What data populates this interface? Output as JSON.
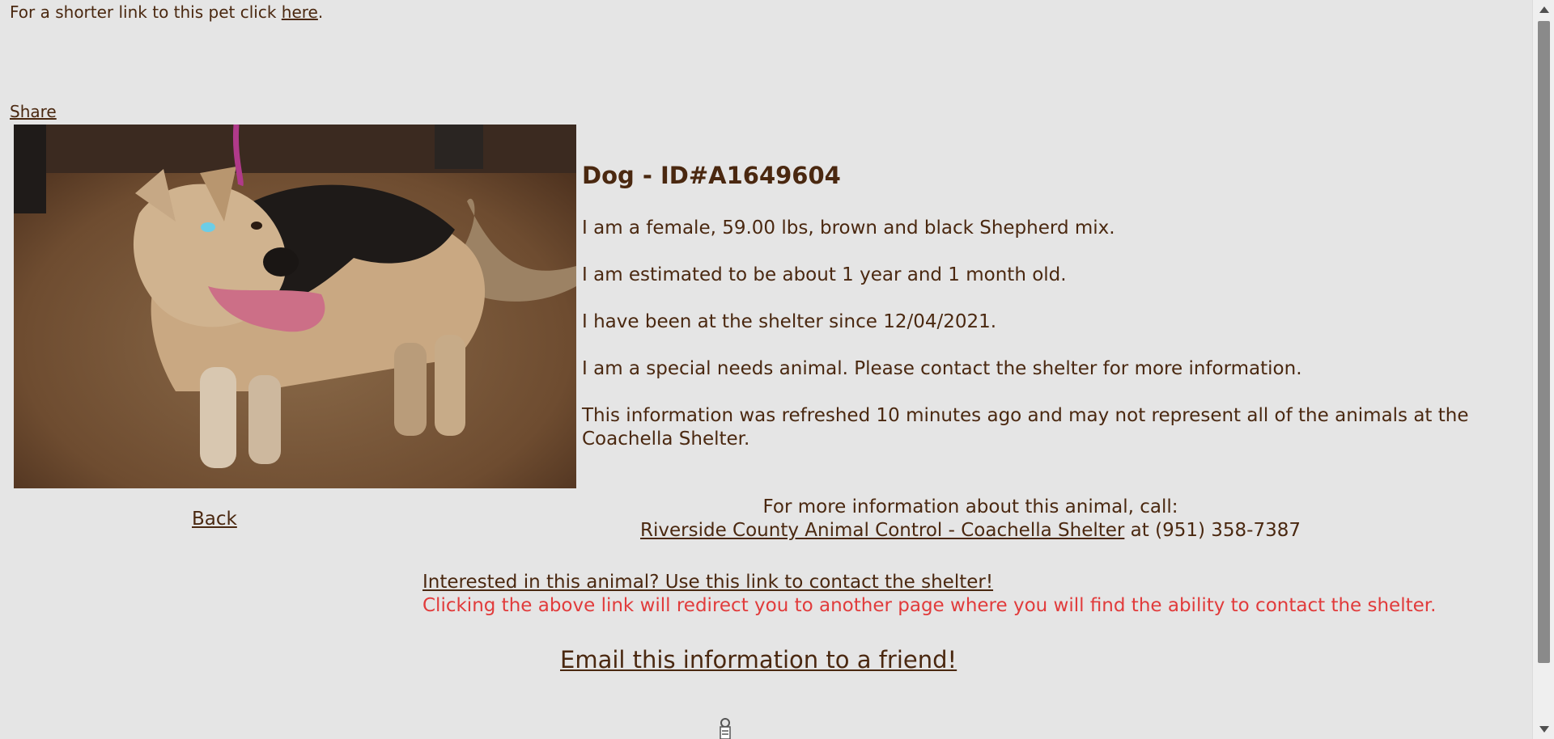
{
  "top": {
    "prefix": "For a shorter link to this pet click ",
    "link": "here",
    "suffix": "."
  },
  "share_label": "Share",
  "photo": {
    "icon": "dog-photo"
  },
  "details": {
    "title": "Dog - ID#A1649604",
    "line1": "I am a female, 59.00 lbs, brown and black Shepherd mix.",
    "line2": "I am estimated to be about 1 year and 1 month old.",
    "line3": "I have been at the shelter since 12/04/2021.",
    "line4": "I am a special needs animal. Please contact the shelter for more information.",
    "line5": "This information was refreshed 10 minutes ago and may not represent all of the animals at the Coachella Shelter."
  },
  "back_label": "Back",
  "more_info": {
    "heading": "For more information about this animal, call:",
    "shelter_link": "Riverside County Animal Control - Coachella Shelter",
    "phone_text": " at (951) 358-7387"
  },
  "interested": {
    "link": "Interested in this animal? Use this link to contact the shelter!",
    "warning": "Clicking the above link will redirect you to another page where you will find the ability to contact the shelter."
  },
  "email_label": "Email this information to a friend!",
  "colors": {
    "background": "#e5e5e5",
    "text": "#4a2810",
    "warning": "#e13b3b"
  }
}
